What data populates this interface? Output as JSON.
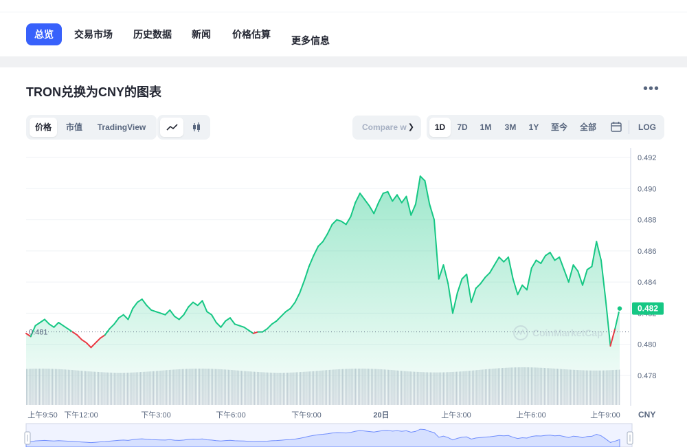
{
  "nav": {
    "tabs": [
      {
        "label": "总览",
        "active": true
      },
      {
        "label": "交易市场"
      },
      {
        "label": "历史数据"
      },
      {
        "label": "新闻"
      },
      {
        "label": "价格估算"
      },
      {
        "label": "更多信息"
      }
    ]
  },
  "page_title": "TRON兑换为CNY的图表",
  "controls": {
    "price": "价格",
    "market_cap": "市值",
    "tradingview": "TradingView",
    "compare_placeholder": "Compare w",
    "ranges": [
      "1D",
      "7D",
      "1M",
      "3M",
      "1Y",
      "至今",
      "全部"
    ],
    "selected_range": "1D",
    "log": "LOG"
  },
  "colors": {
    "up": "#16c784",
    "down": "#ea3943",
    "accent": "#3861fb",
    "current_bg": "#16c784"
  },
  "watermark": "CoinMarketCap",
  "chart_data": {
    "type": "area",
    "currency": "CNY",
    "y_ticks": [
      "0.492",
      "0.490",
      "0.488",
      "0.486",
      "0.484",
      "0.482",
      "0.480",
      "0.478"
    ],
    "ylim": [
      0.4762,
      0.4931
    ],
    "x_ticks": [
      "上午9:50",
      "下午12:00",
      "下午3:00",
      "下午6:00",
      "下午9:00",
      "20日",
      "上午3:00",
      "上午6:00",
      "上午9:00"
    ],
    "open_price_label": "0.481",
    "open_price": 0.4808,
    "current_price_label": "0.482",
    "current_price": 0.4823,
    "points": [
      0.4807,
      0.4805,
      0.4812,
      0.4814,
      0.4816,
      0.4813,
      0.4811,
      0.4814,
      0.4812,
      0.481,
      0.4808,
      0.4806,
      0.4803,
      0.4801,
      0.4798,
      0.4801,
      0.4804,
      0.4806,
      0.481,
      0.4813,
      0.4817,
      0.4819,
      0.4816,
      0.4823,
      0.4827,
      0.4829,
      0.4825,
      0.4822,
      0.4821,
      0.482,
      0.4819,
      0.4822,
      0.4818,
      0.4816,
      0.4819,
      0.4824,
      0.4827,
      0.4825,
      0.4828,
      0.4821,
      0.4819,
      0.4814,
      0.4811,
      0.4815,
      0.4817,
      0.4813,
      0.4812,
      0.4811,
      0.4809,
      0.4807,
      0.4808,
      0.4808,
      0.481,
      0.4813,
      0.4815,
      0.4818,
      0.4821,
      0.4823,
      0.4827,
      0.4833,
      0.4841,
      0.485,
      0.4857,
      0.4863,
      0.4866,
      0.4871,
      0.4877,
      0.488,
      0.4879,
      0.4877,
      0.4882,
      0.4891,
      0.4897,
      0.4893,
      0.4889,
      0.4884,
      0.4891,
      0.4897,
      0.4898,
      0.4892,
      0.4896,
      0.4891,
      0.4895,
      0.4883,
      0.489,
      0.4908,
      0.4905,
      0.489,
      0.488,
      0.4842,
      0.4851,
      0.4839,
      0.482,
      0.4833,
      0.4842,
      0.4845,
      0.4827,
      0.4836,
      0.4839,
      0.4843,
      0.4846,
      0.4851,
      0.4856,
      0.4853,
      0.4856,
      0.4842,
      0.4832,
      0.4838,
      0.4835,
      0.4849,
      0.4854,
      0.4852,
      0.4857,
      0.4859,
      0.4854,
      0.4856,
      0.4848,
      0.484,
      0.4851,
      0.4847,
      0.4838,
      0.4848,
      0.485,
      0.4866,
      0.4854,
      0.4828,
      0.4799,
      0.481,
      0.4823
    ]
  }
}
